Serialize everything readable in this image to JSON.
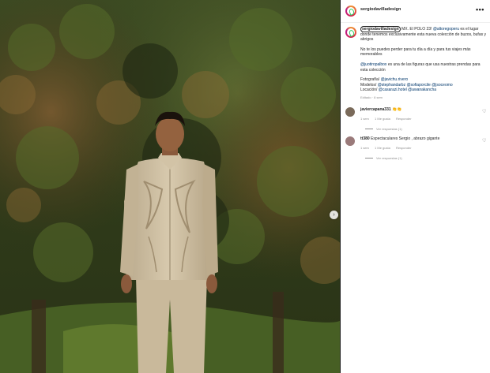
{
  "post": {
    "username": "sergiodavilladesign",
    "more_label": "•••",
    "caption": {
      "line1_after_user": " MX. El POLO 23! ",
      "mention1": "@altoregoperu",
      "line1_rest": " es el lugar donde tenemos exclusivamente esta nueva colección de buzos, bufas y abrigos",
      "para2": "No te los puedes perder para tu día a día y para tus viajes más memorables",
      "para3_mention": "@juotiropalbox",
      "para3_rest": " es una de las figuras que usa nuestras prendas para esta colección",
      "photo_label": "Fotografía/ ",
      "photo_mention": "@javichu.rivero",
      "models_label": "Modelos/ ",
      "models_mentions": "@stephandarbz @sofiaporcile @jsoceomo",
      "location_label": "Locación/ ",
      "location_mentions": "@casarazi.hotel @awanakancha",
      "edited": "Editado · 8 sem"
    }
  },
  "comments": [
    {
      "username": "javiercapana331",
      "text": " 👏👏",
      "time": "1 sem",
      "likes": "1 Me gusta",
      "reply": "Responder",
      "replies": "Ver respuestas (1)",
      "avatar_color": "#7a6a5a"
    },
    {
      "username": "tt380",
      "text": " Espectaculares Sergio , abrazo gigante",
      "time": "1 sem",
      "likes": "1 Me gusta",
      "reply": "Responder",
      "replies": "Ver respuestas (1)",
      "avatar_color": "#9a7a7a"
    }
  ],
  "icons": {
    "carousel_next": "›",
    "heart": "♡"
  },
  "colors": {
    "mention": "#00376b",
    "meta": "#8e8e8e",
    "panel_bg": "#ffffff"
  }
}
